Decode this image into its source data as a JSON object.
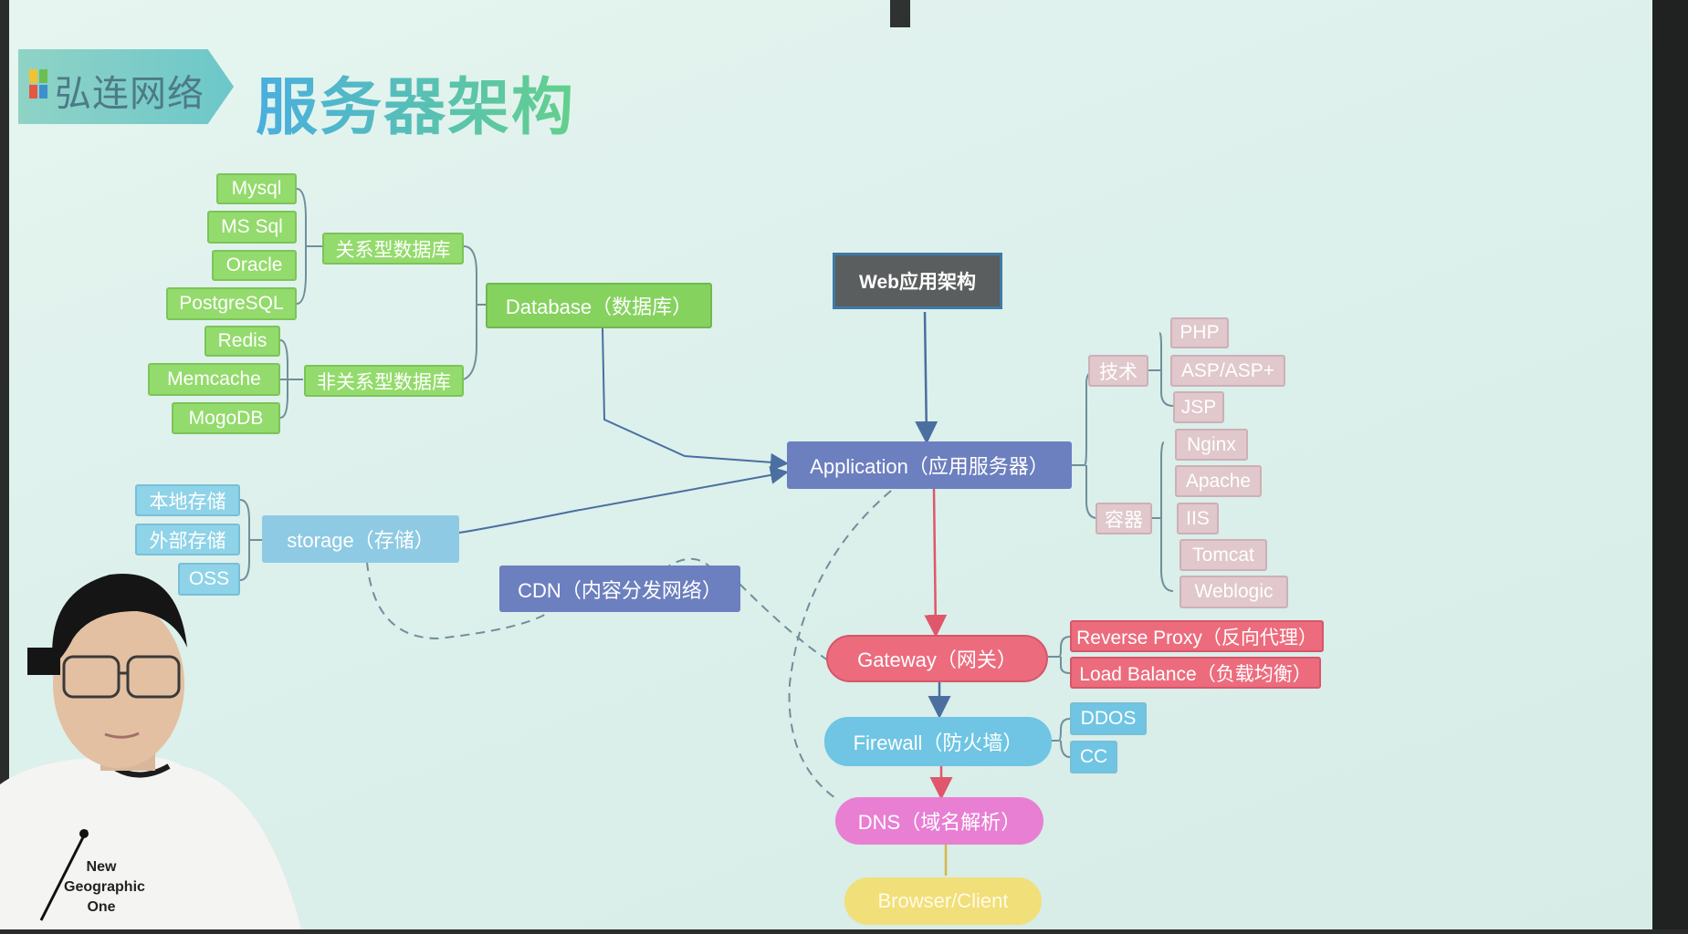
{
  "header": {
    "brand": "弘连网络",
    "title": "服务器架构"
  },
  "colors": {
    "green": "#93db6c",
    "cyan": "#8fd3e8",
    "pink": "#e0c8cc",
    "red": "#ec6c7d",
    "blue": "#6c7fbf",
    "magenta": "#e87fd3",
    "yellow": "#f1df79"
  },
  "nodes": {
    "root": "Web应用架构",
    "application": "Application（应用服务器）",
    "tech": "技术",
    "php": "PHP",
    "asp": "ASP/ASP+",
    "jsp": "JSP",
    "container": "容器",
    "nginx": "Nginx",
    "apache": "Apache",
    "iis": "IIS",
    "tomcat": "Tomcat",
    "weblogic": "Weblogic",
    "database": "Database（数据库）",
    "relational": "关系型数据库",
    "mysql": "Mysql",
    "mssql": "MS Sql",
    "oracle": "Oracle",
    "postgresql": "PostgreSQL",
    "nonrelational": "非关系型数据库",
    "redis": "Redis",
    "memcache": "Memcache",
    "mogodb": "MogoDB",
    "storage": "storage（存储）",
    "local_storage": "本地存储",
    "external_storage": "外部存储",
    "oss": "OSS",
    "cdn": "CDN（内容分发网络）",
    "gateway": "Gateway（网关）",
    "reverse_proxy": "Reverse Proxy（反向代理）",
    "load_balance": "Load Balance（负载均衡）",
    "firewall": "Firewall（防火墙）",
    "ddos": "DDOS",
    "cc": "CC",
    "dns": "DNS（域名解析）",
    "browser": "Browser/Client"
  },
  "shirt_text": [
    "New",
    "Geographic",
    "One"
  ]
}
